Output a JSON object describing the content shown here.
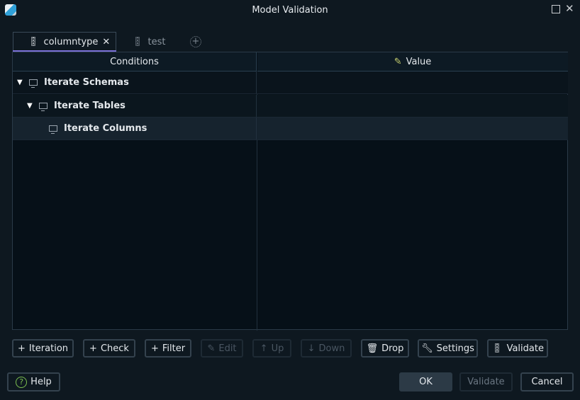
{
  "window": {
    "title": "Model Validation"
  },
  "tabs": [
    {
      "label": "columntype",
      "close": "✕"
    },
    {
      "label": "test"
    }
  ],
  "grid": {
    "headers": {
      "conditions": "Conditions",
      "value": "Value"
    },
    "rows": [
      {
        "label": "Iterate Schemas",
        "expanded": true
      },
      {
        "label": "Iterate Tables",
        "expanded": true
      },
      {
        "label": "Iterate Columns"
      }
    ]
  },
  "toolbar": {
    "iteration": "Iteration",
    "check": "Check",
    "filter": "Filter",
    "edit": "Edit",
    "up": "Up",
    "down": "Down",
    "drop": "Drop",
    "settings": "Settings",
    "validate": "Validate"
  },
  "footer": {
    "help": "Help",
    "ok": "OK",
    "validate": "Validate",
    "cancel": "Cancel"
  },
  "colors": {
    "accent": "#7a70d6",
    "background": "#0e1820"
  }
}
